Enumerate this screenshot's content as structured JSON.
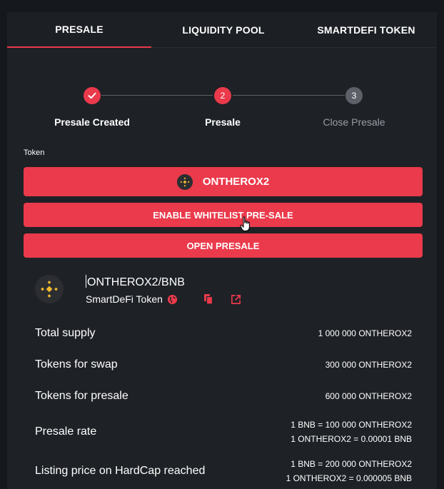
{
  "tabs": [
    {
      "label": "PRESALE",
      "active": true
    },
    {
      "label": "LIQUIDITY POOL",
      "active": false
    },
    {
      "label": "SMARTDEFI TOKEN",
      "active": false
    }
  ],
  "stepper": {
    "steps": [
      {
        "label": "Presale Created",
        "status": "done",
        "badge": ""
      },
      {
        "label": "Presale",
        "status": "current",
        "badge": "2"
      },
      {
        "label": "Close Presale",
        "status": "pending",
        "badge": "3"
      }
    ]
  },
  "token_section": {
    "label": "Token",
    "token_button": "ONTHEROX2",
    "whitelist_button": "ENABLE WHITELIST PRE-SALE",
    "open_button": "OPEN PRESALE"
  },
  "pair": {
    "name": "ONTHEROX2/BNB",
    "subtitle": "SmartDeFi Token"
  },
  "stats": [
    {
      "label": "Total supply",
      "value_lines": [
        "1 000 000 ONTHEROX2"
      ]
    },
    {
      "label": "Tokens for swap",
      "value_lines": [
        "300 000 ONTHEROX2"
      ]
    },
    {
      "label": "Tokens for presale",
      "value_lines": [
        "600 000 ONTHEROX2"
      ]
    },
    {
      "label": "Presale rate",
      "value_lines": [
        "1 BNB = 100 000 ONTHEROX2",
        "1 ONTHEROX2 = 0.00001 BNB"
      ]
    },
    {
      "label": "Listing price on HardCap reached",
      "value_lines": [
        "1 BNB = 200 000 ONTHEROX2",
        "1 ONTHEROX2 = 0.000005 BNB"
      ]
    }
  ],
  "colors": {
    "accent": "#ea3a4b",
    "background": "#1e2126",
    "pending_step": "#5d6068",
    "bnb_yellow": "#f3ba2f"
  },
  "icons": {
    "check": "check-icon",
    "globe": "globe-icon",
    "copy": "copy-icon",
    "external": "external-link-icon",
    "bnb": "bnb-logo-icon",
    "cursor": "hand-cursor-icon"
  }
}
